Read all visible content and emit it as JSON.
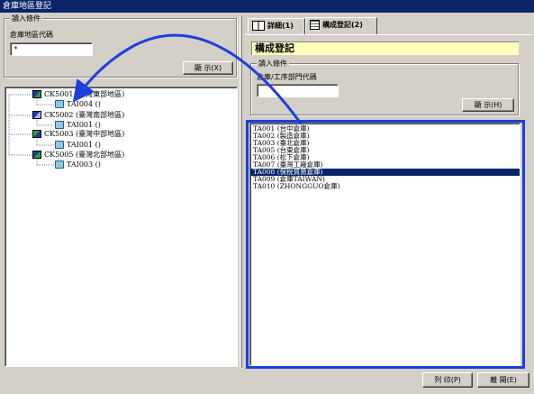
{
  "window": {
    "title": "倉庫地區登記"
  },
  "left": {
    "group_title": "讀入條件",
    "code_label": "倉庫地區代碼",
    "code_value": "*",
    "display_button": "顯 示(X)",
    "tree": [
      {
        "label": "CK5001 (臺灣東部地區)",
        "icon": "region-icon",
        "children": [
          "TAI004 ()"
        ]
      },
      {
        "label": "CK5002 (臺灣南部地區)",
        "icon": "region-icon",
        "children": [
          "TAI001 ()"
        ]
      },
      {
        "label": "CK5003 (臺灣中部地區)",
        "icon": "region-icon",
        "children": [
          "TAI001 ()"
        ]
      },
      {
        "label": "CK5005 (臺灣北部地區)",
        "icon": "region-icon",
        "children": [
          "TAI003 ()"
        ]
      }
    ]
  },
  "tabs": [
    {
      "label": "詳細(1)",
      "icon": "book-icon"
    },
    {
      "label": "構成登記(2)",
      "icon": "form-icon"
    }
  ],
  "right": {
    "section_title": "構成登記",
    "group_title": "讀入條件",
    "dept_label": "倉庫/工序部門代碼",
    "dept_value": "",
    "display_button": "顯 示(H)",
    "list_items": [
      "TA001 (台中倉庫)",
      "TA002 (製造倉庫)",
      "TA003 (臺北倉庫)",
      "TA005 (台東倉庫)",
      "TA006 (松下倉庫)",
      "TA007 (臺灣工廠倉庫)",
      "TA008 (保稅貿易倉庫)",
      "TA009 (倉庫TAIWAN)",
      "TA010 (ZHONGGUO倉庫)"
    ],
    "selected_index": 6
  },
  "footer": {
    "print_button": "列 印(P)",
    "close_button": "離 開(E)"
  },
  "colors": {
    "titlebar": "#0a246a",
    "annotation": "#1c3fe0",
    "section_bg": "#ffffc0",
    "selection": "#0a246a"
  }
}
